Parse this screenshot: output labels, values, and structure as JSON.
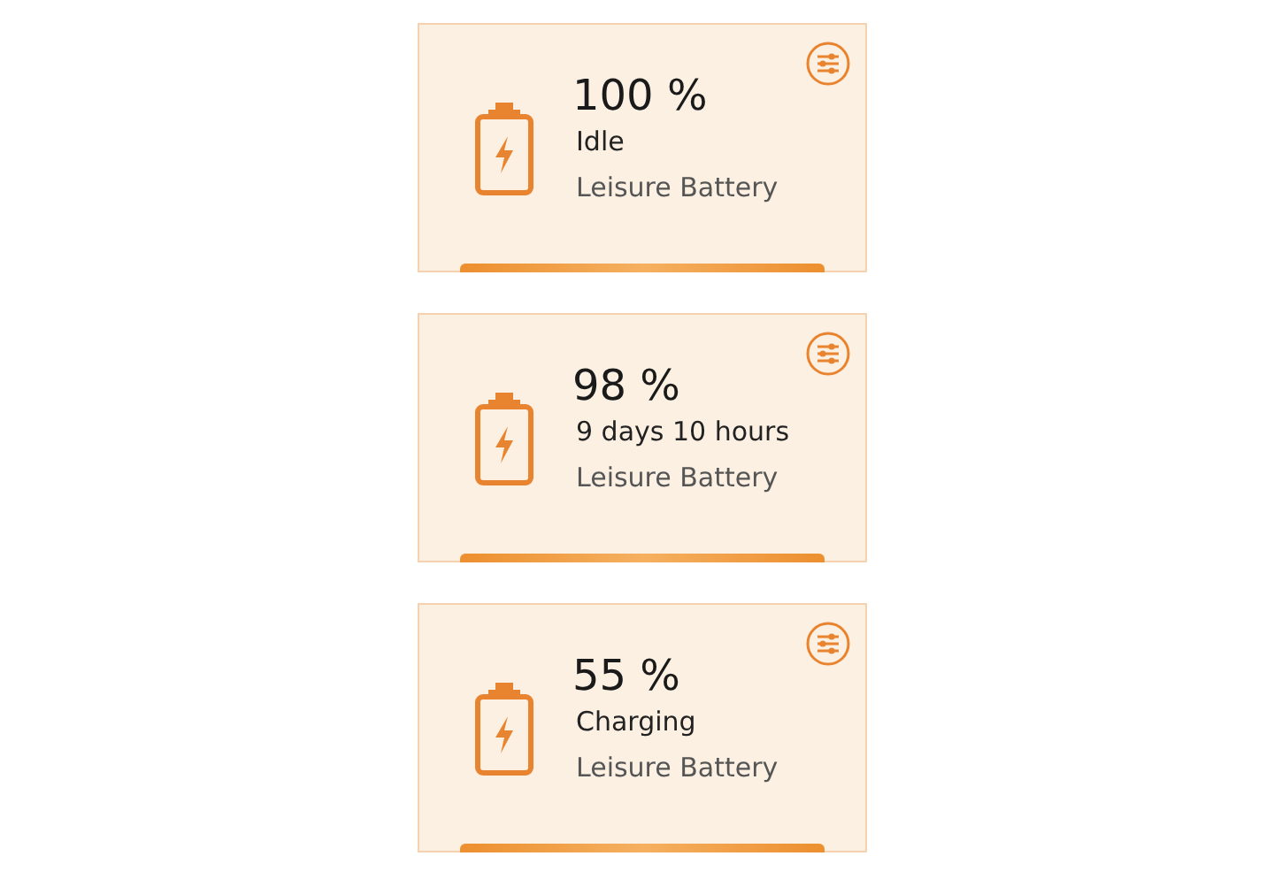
{
  "batteries": [
    {
      "percent": "100 %",
      "status": "Idle",
      "name": "Leisure Battery"
    },
    {
      "percent": "98 %",
      "status": "9 days 10 hours",
      "name": "Leisure Battery"
    },
    {
      "percent": "55 %",
      "status": "Charging",
      "name": "Leisure Battery"
    }
  ]
}
